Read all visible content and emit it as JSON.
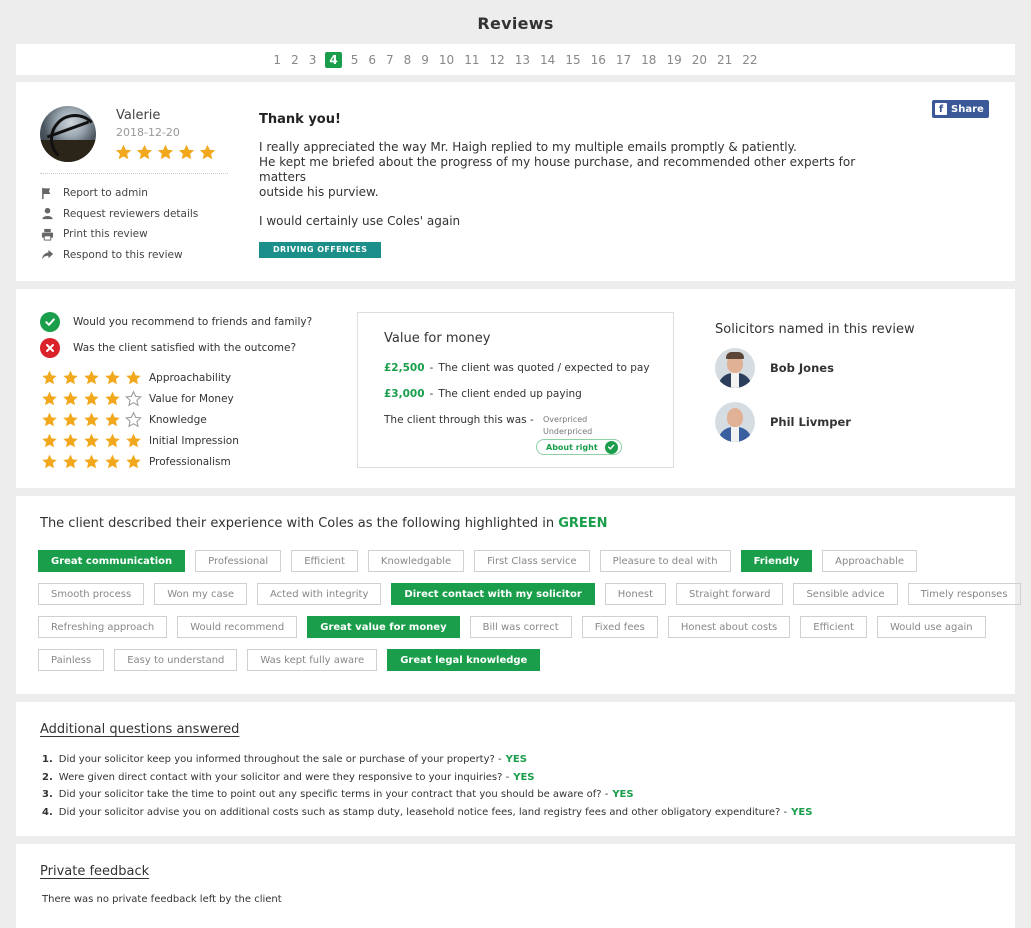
{
  "page": {
    "title": "Reviews"
  },
  "colors": {
    "accent_green": "#1a9e4b",
    "teal_tag": "#1d8f8a",
    "facebook": "#3b5998",
    "star": "#f2a81d",
    "red": "#d9222a"
  },
  "pagination": {
    "pages": [
      "1",
      "2",
      "3",
      "4",
      "5",
      "6",
      "7",
      "8",
      "9",
      "10",
      "11",
      "12",
      "13",
      "14",
      "15",
      "16",
      "17",
      "18",
      "19",
      "20",
      "21",
      "22"
    ],
    "current": "4"
  },
  "review": {
    "reviewer_name": "Valerie",
    "date": "2018-12-20",
    "rating": 5,
    "actions": [
      {
        "icon": "flag-icon",
        "label": "Report to admin"
      },
      {
        "icon": "user-icon",
        "label": "Request reviewers details"
      },
      {
        "icon": "print-icon",
        "label": "Print this review"
      },
      {
        "icon": "reply-arrow-icon",
        "label": "Respond to this review"
      }
    ],
    "title": "Thank you!",
    "paragraph_1": "I really appreciated the way Mr. Haigh replied to my multiple emails promptly & patiently.\nHe kept me briefed about the progress of my house purchase, and recommended other experts for matters\noutside his purview.",
    "paragraph_2": "I would certainly use Coles' again",
    "category": "DRIVING OFFENCES",
    "share_label": "Share"
  },
  "ratings": {
    "questions": [
      {
        "text": "Would you recommend to friends and family?",
        "answer": "yes"
      },
      {
        "text": "Was the client satisfied with the outcome?",
        "answer": "no"
      }
    ],
    "categories": [
      {
        "label": "Approachability",
        "stars": 5
      },
      {
        "label": "Value for Money",
        "stars": 4
      },
      {
        "label": "Knowledge",
        "stars": 4
      },
      {
        "label": "Initial Impression",
        "stars": 5
      },
      {
        "label": "Professionalism",
        "stars": 5
      }
    ],
    "value_for_money": {
      "title": "Value for money",
      "quoted_amount": "£2,500",
      "quoted_sep": "-",
      "quoted_text": "The client was quoted / expected to pay",
      "paid_amount": "£3,000",
      "paid_sep": "-",
      "paid_text": "The client ended up paying",
      "through_label": "The client through this was  -",
      "option_overpriced": "Overpriced",
      "option_underpriced": "Underpriced",
      "selected": "About right"
    },
    "solicitors_title": "Solicitors named in this review",
    "solicitors": [
      {
        "name": "Bob Jones"
      },
      {
        "name": "Phil Livmper"
      }
    ]
  },
  "highlights": {
    "heading_prefix": "The client described their experience with Coles as the following highlighted in",
    "heading_keyword": "GREEN",
    "rows": [
      [
        {
          "label": "Great communication",
          "on": true
        },
        {
          "label": "Professional",
          "on": false
        },
        {
          "label": "Efficient",
          "on": false
        },
        {
          "label": "Knowledgable",
          "on": false
        },
        {
          "label": "First Class service",
          "on": false
        },
        {
          "label": "Pleasure to deal with",
          "on": false
        },
        {
          "label": "Friendly",
          "on": true
        },
        {
          "label": "Approachable",
          "on": false
        }
      ],
      [
        {
          "label": "Smooth process",
          "on": false
        },
        {
          "label": "Won my case",
          "on": false
        },
        {
          "label": "Acted with integrity",
          "on": false
        },
        {
          "label": "Direct contact with my solicitor",
          "on": true
        },
        {
          "label": "Honest",
          "on": false
        },
        {
          "label": "Straight forward",
          "on": false
        },
        {
          "label": "Sensible advice",
          "on": false
        },
        {
          "label": "Timely responses",
          "on": false
        }
      ],
      [
        {
          "label": "Refreshing approach",
          "on": false
        },
        {
          "label": "Would recommend",
          "on": false
        },
        {
          "label": "Great value for money",
          "on": true
        },
        {
          "label": "Bill was correct",
          "on": false
        },
        {
          "label": "Fixed fees",
          "on": false
        },
        {
          "label": "Honest about costs",
          "on": false
        },
        {
          "label": "Efficient",
          "on": false
        },
        {
          "label": "Would use again",
          "on": false
        }
      ],
      [
        {
          "label": "Painless",
          "on": false
        },
        {
          "label": "Easy to understand",
          "on": false
        },
        {
          "label": "Was kept fully aware",
          "on": false
        },
        {
          "label": "Great legal knowledge",
          "on": true
        }
      ]
    ]
  },
  "additional_questions": {
    "heading": "Additional questions answered",
    "items": [
      {
        "num": "1.",
        "text": "Did your solicitor keep you informed throughout the sale or purchase of your property?  -",
        "answer": "YES"
      },
      {
        "num": "2.",
        "text": "Were given direct contact with your solicitor and were they responsive to your inquiries?  -",
        "answer": "YES"
      },
      {
        "num": "3.",
        "text": "Did your solicitor take the time to point out any specific terms in your contract that you should be aware of?  -",
        "answer": "YES"
      },
      {
        "num": "4.",
        "text": "Did your solicitor advise you on additional costs such as stamp duty, leasehold notice fees, land registry fees and other obligatory expenditure?  -",
        "answer": "YES"
      }
    ]
  },
  "private_feedback": {
    "heading": "Private feedback",
    "text": "There was no private feedback left by the client"
  }
}
